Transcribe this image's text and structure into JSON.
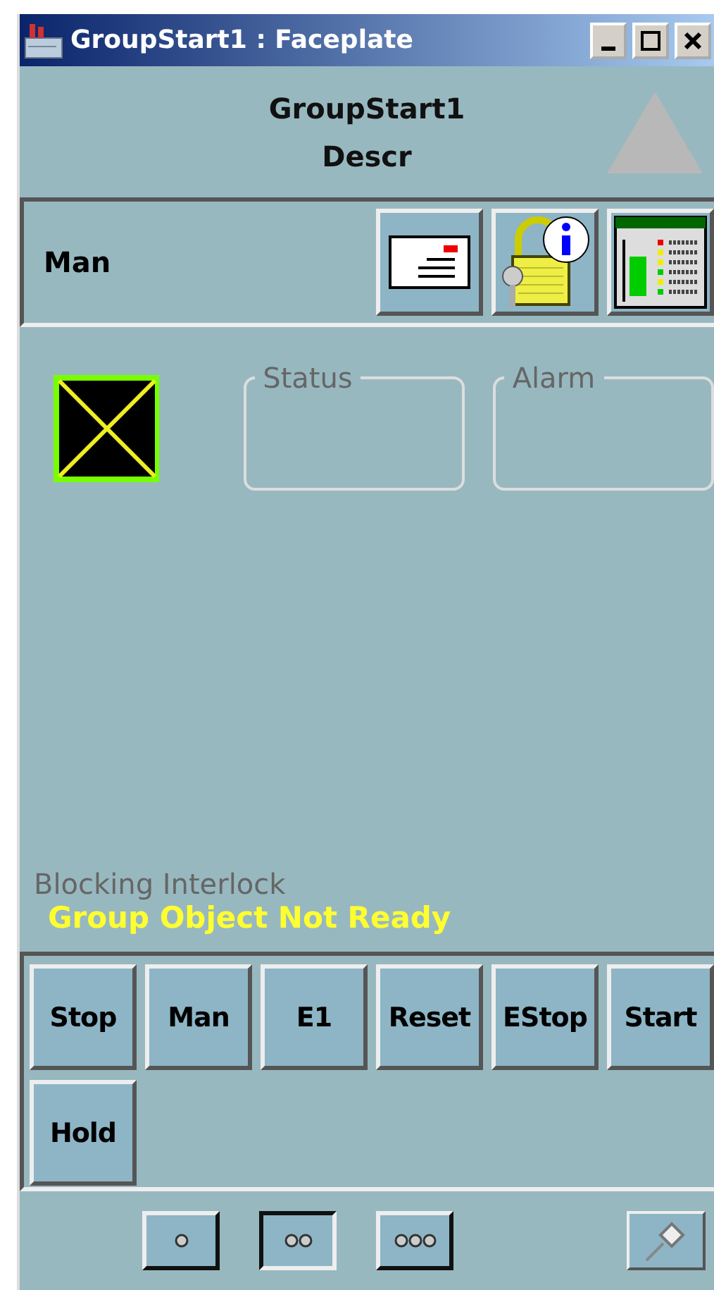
{
  "window": {
    "title": "GroupStart1 : Faceplate",
    "controls": [
      {
        "kind": "minimize"
      },
      {
        "kind": "maximize"
      },
      {
        "kind": "close"
      }
    ]
  },
  "header": {
    "name": "GroupStart1",
    "description": "Descr"
  },
  "toolbar": {
    "mode": "Man",
    "buttons": [
      {
        "kind": "message"
      },
      {
        "kind": "lock-info"
      },
      {
        "kind": "panel"
      }
    ]
  },
  "groups": [
    {
      "label": "Status"
    },
    {
      "label": "Alarm"
    }
  ],
  "interlock": {
    "label": "Blocking Interlock",
    "message": "Group Object Not Ready"
  },
  "commands": [
    {
      "label": "Stop"
    },
    {
      "label": "Man"
    },
    {
      "label": "E1"
    },
    {
      "label": "Reset"
    },
    {
      "label": "EStop"
    },
    {
      "label": "Start"
    },
    {
      "label": "Hold"
    }
  ],
  "view_sizes": [
    {
      "selected": false
    },
    {
      "selected": true
    },
    {
      "selected": false
    }
  ],
  "pin": {
    "kind": "pin"
  }
}
